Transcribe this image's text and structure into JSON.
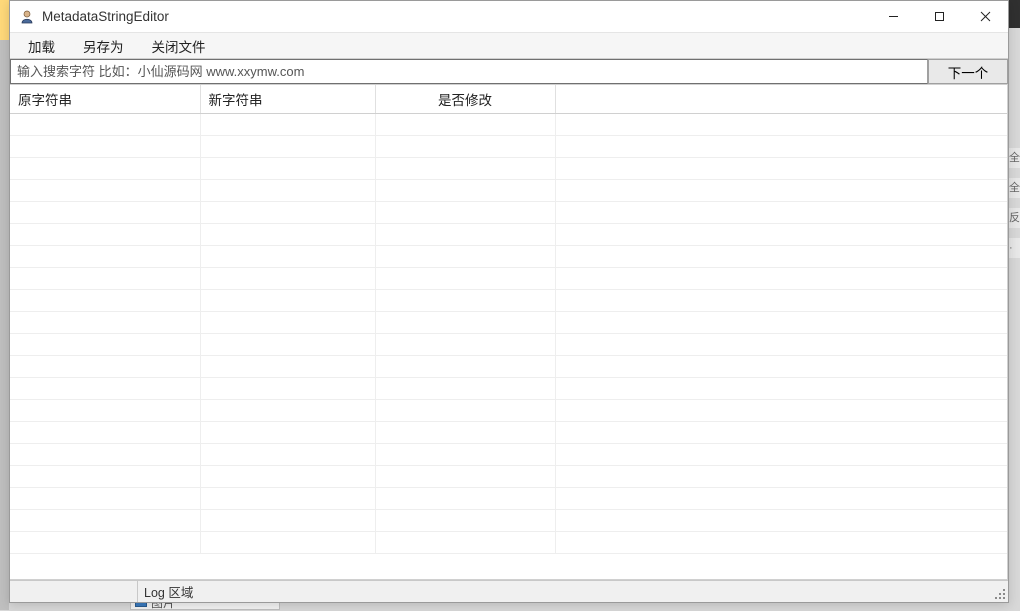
{
  "window": {
    "title": "MetadataStringEditor"
  },
  "menu": {
    "load": "加载",
    "save_as": "另存为",
    "close_file": "关闭文件"
  },
  "search": {
    "placeholder": "输入搜索字符 比如：小仙源码网 www.xxymw.com",
    "value": "",
    "next_label": "下一个"
  },
  "table": {
    "columns": {
      "original": "原字符串",
      "new": "新字符串",
      "modified": "是否修改"
    },
    "rows": []
  },
  "status": {
    "first": "",
    "log_label": "Log 区域"
  },
  "bg": {
    "bottom_label": "图片"
  }
}
